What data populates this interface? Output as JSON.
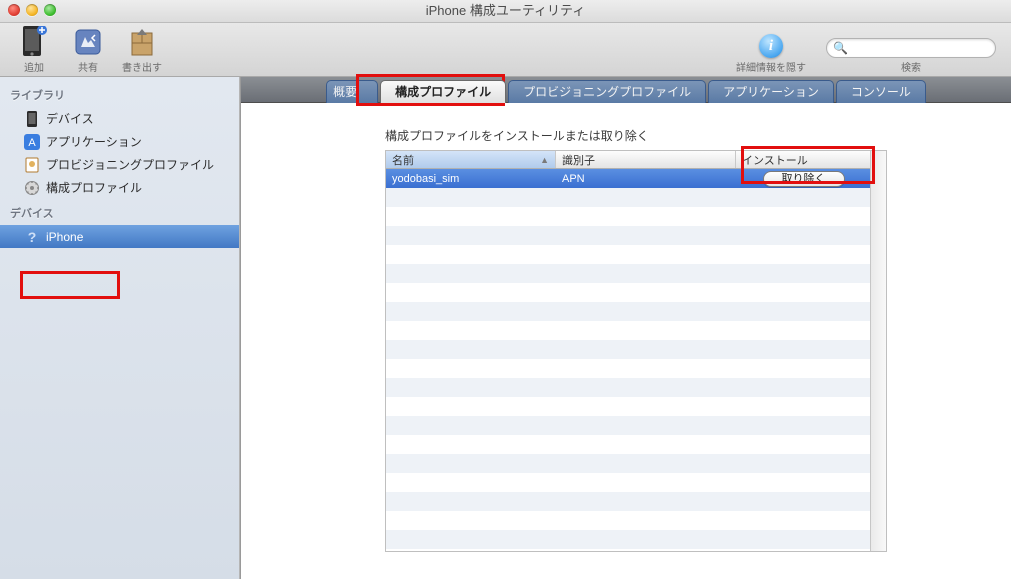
{
  "window": {
    "title": "iPhone 構成ユーティリティ"
  },
  "toolbar": {
    "add": {
      "label": "追加"
    },
    "share": {
      "label": "共有"
    },
    "export": {
      "label": "書き出す"
    },
    "info": {
      "label": "詳細情報を隠す",
      "glyph": "i"
    },
    "search": {
      "label": "検索",
      "placeholder": ""
    }
  },
  "sidebar": {
    "section_library": "ライブラリ",
    "section_devices": "デバイス",
    "library_items": [
      {
        "label": "デバイス"
      },
      {
        "label": "アプリケーション"
      },
      {
        "label": "プロビジョニングプロファイル"
      },
      {
        "label": "構成プロファイル"
      }
    ],
    "device_items": [
      {
        "label": "iPhone"
      }
    ]
  },
  "tabs": {
    "items": [
      {
        "label": "概要"
      },
      {
        "label": "構成プロファイル",
        "active": true
      },
      {
        "label": "プロビジョニングプロファイル"
      },
      {
        "label": "アプリケーション"
      },
      {
        "label": "コンソール"
      }
    ]
  },
  "content": {
    "description": "構成プロファイルをインストールまたは取り除く",
    "columns": {
      "name": "名前",
      "id": "識別子",
      "install": "インストール"
    },
    "rows": [
      {
        "name": "yodobasi_sim",
        "id": "APN",
        "action_label": "取り除く",
        "selected": true
      }
    ]
  }
}
